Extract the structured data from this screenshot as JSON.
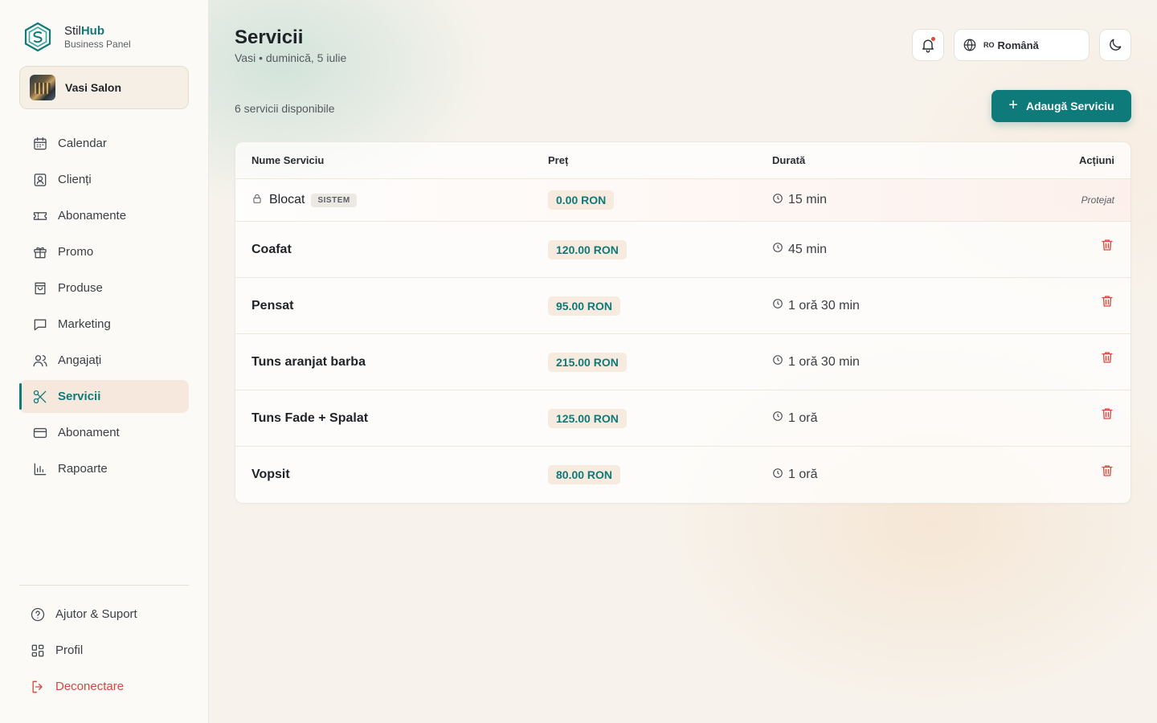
{
  "brand": {
    "name_prefix": "Stil",
    "name_suffix": "Hub",
    "subtitle": "Business Panel"
  },
  "salon": {
    "name": "Vasi Salon"
  },
  "sidebar": {
    "items": [
      {
        "label": "Calendar",
        "icon": "calendar-icon"
      },
      {
        "label": "Clienți",
        "icon": "user-badge-icon"
      },
      {
        "label": "Abonamente",
        "icon": "ticket-icon"
      },
      {
        "label": "Promo",
        "icon": "gift-icon"
      },
      {
        "label": "Produse",
        "icon": "shopping-bag-icon"
      },
      {
        "label": "Marketing",
        "icon": "message-icon"
      },
      {
        "label": "Angajați",
        "icon": "users-icon"
      },
      {
        "label": "Servicii",
        "icon": "scissors-icon",
        "active": true
      },
      {
        "label": "Abonament",
        "icon": "credit-card-icon"
      },
      {
        "label": "Rapoarte",
        "icon": "bar-chart-icon"
      }
    ],
    "bottom": [
      {
        "label": "Ajutor & Suport",
        "icon": "help-circle-icon"
      },
      {
        "label": "Profil",
        "icon": "grid-icon"
      },
      {
        "label": "Deconectare",
        "icon": "logout-icon"
      }
    ]
  },
  "header": {
    "title": "Servicii",
    "subtitle": "Vasi • duminică, 5 iulie",
    "language_code": "RO",
    "language_label": "Română"
  },
  "toolbar": {
    "count_text": "6 servicii disponibile",
    "add_label": "Adaugă Serviciu"
  },
  "table": {
    "columns": {
      "name": "Nume Serviciu",
      "price": "Preț",
      "duration": "Durată",
      "actions": "Acțiuni"
    },
    "system_row": {
      "name": "Blocat",
      "badge": "SISTEM",
      "price": "0.00 RON",
      "duration": "15 min",
      "action": "Protejat"
    },
    "rows": [
      {
        "name": "Coafat",
        "price": "120.00 RON",
        "duration": "45 min"
      },
      {
        "name": "Pensat",
        "price": "95.00 RON",
        "duration": "1 oră 30 min"
      },
      {
        "name": "Tuns aranjat barba",
        "price": "215.00 RON",
        "duration": "1 oră 30 min"
      },
      {
        "name": "Tuns Fade + Spalat",
        "price": "125.00 RON",
        "duration": "1 oră"
      },
      {
        "name": "Vopsit",
        "price": "80.00 RON",
        "duration": "1 oră"
      }
    ]
  },
  "colors": {
    "accent": "#0f7a7a",
    "danger": "#e0463c",
    "price_bg": "#f6ebde"
  }
}
